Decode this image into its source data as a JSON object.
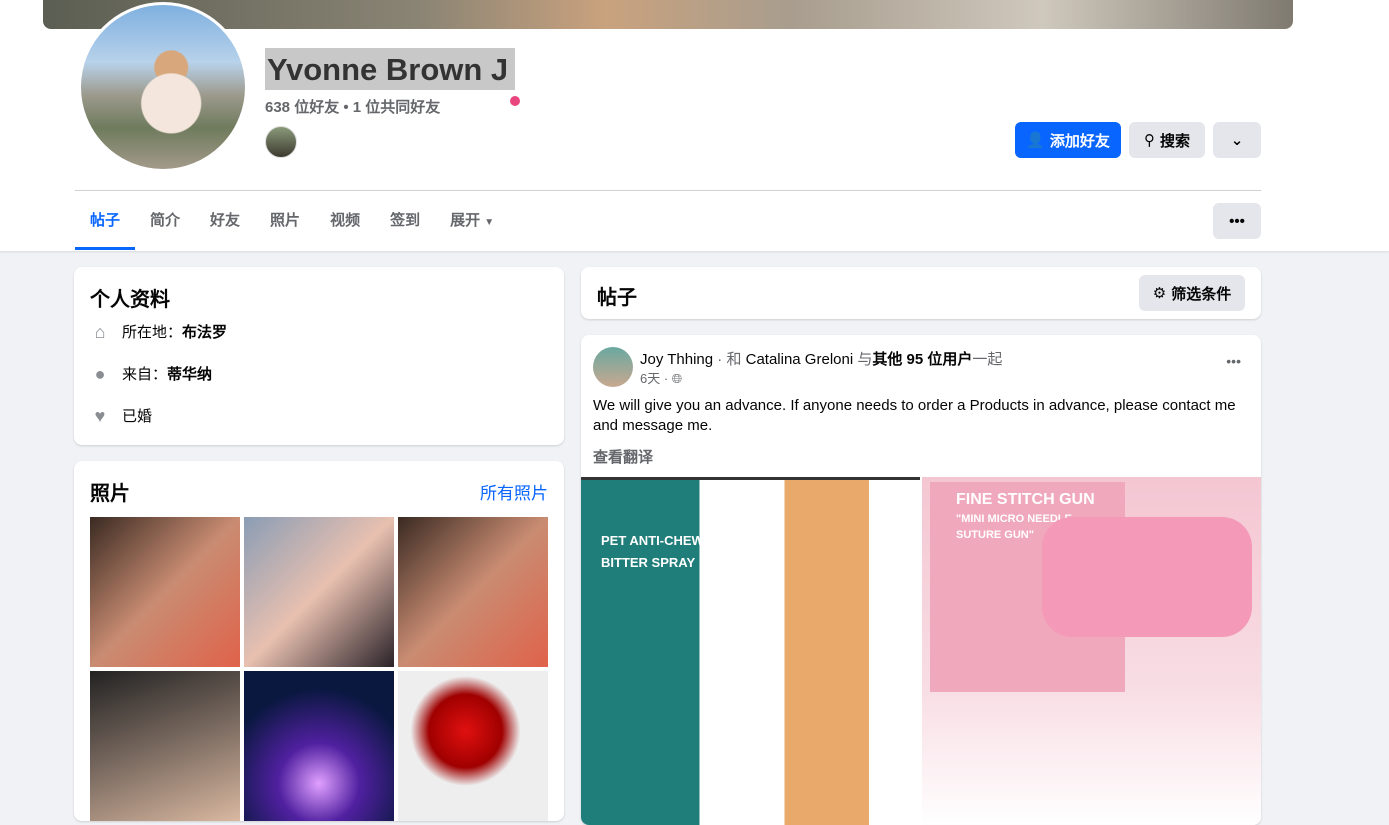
{
  "profile": {
    "name": "Yvonne Brown J",
    "friends": "638 位好友 • 1 位共同好友"
  },
  "actions": {
    "add_friend": "添加好友",
    "search": "搜索"
  },
  "tabs": [
    "帖子",
    "简介",
    "好友",
    "照片",
    "视频",
    "签到",
    "展开"
  ],
  "intro": {
    "title": "个人资料",
    "location_label": "所在地：",
    "location": "布法罗",
    "from_label": "来自：",
    "from": "蒂华纳",
    "relationship": "已婚"
  },
  "photos": {
    "title": "照片",
    "all": "所有照片"
  },
  "posts": {
    "title": "帖子",
    "filter": "筛选条件"
  },
  "post": {
    "author": "Joy Thhing",
    "sep": " · 和 ",
    "tagged": "Catalina Greloni",
    "with": " 与",
    "others": "其他 95 位用户",
    "tail": "一起",
    "time": "6天 ·",
    "text": "We will give you an advance. If anyone needs to order a Products in advance, please contact me and message me.",
    "translate": "查看翻译",
    "image1_text": [
      "PET ANTI-CHEW",
      "BITTER SPRAY"
    ],
    "image2_text": [
      "FINE STITCH GUN",
      "\"MINI MICRO NEEDLE",
      "SUTURE GUN\""
    ]
  },
  "colors": {
    "accent": "#0866ff",
    "text_secondary": "#65676b"
  }
}
